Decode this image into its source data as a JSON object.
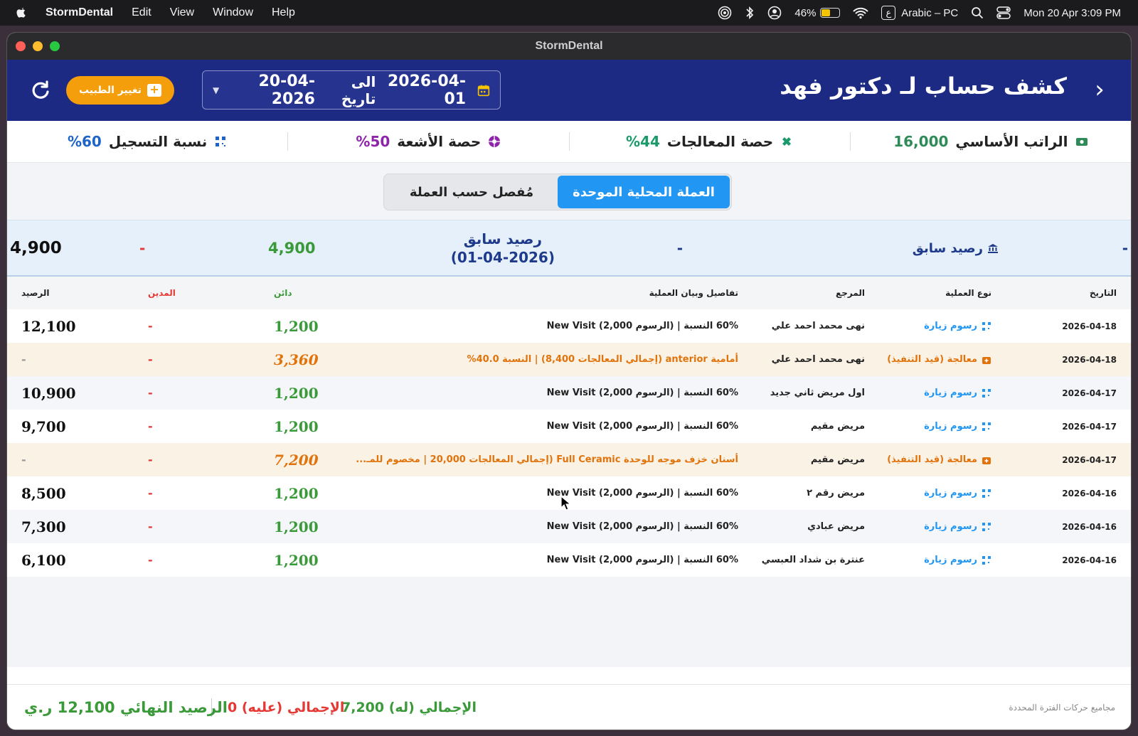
{
  "menubar": {
    "app_name": "StormDental",
    "menus": [
      "Edit",
      "View",
      "Window",
      "Help"
    ],
    "battery_percent": "46%",
    "battery_level": 0.46,
    "input_source": "Arabic – PC",
    "input_indicator": "ع",
    "datetime": "Mon 20 Apr  3:09 PM"
  },
  "window": {
    "title": "StormDental"
  },
  "header": {
    "title": "كشف حساب لـ دكتور فهد",
    "date_from": "2026-04-01",
    "date_sep": "الى تاريخ",
    "date_to": "20-04-2026",
    "change_doctor": "تغيير الطبيب"
  },
  "stats": [
    {
      "label": "الراتب الأساسي",
      "value": "16,000",
      "color": "#2e8b57",
      "icon": "money-icon"
    },
    {
      "label": "حصة المعالجات",
      "value": "%44",
      "color": "#1a9a6a",
      "icon": "tooth-icon"
    },
    {
      "label": "حصة الأشعة",
      "value": "%50",
      "color": "#8e24aa",
      "icon": "xray-icon"
    },
    {
      "label": "نسبة التسجيل",
      "value": "%60",
      "color": "#1e64c8",
      "icon": "qr-icon"
    }
  ],
  "toggle": {
    "active": "العملة المحلية الموحدة",
    "inactive": "مُفصل حسب العملة"
  },
  "previous": {
    "dash": "-",
    "label": "رصيد سابق",
    "mid_dash": "-",
    "mid_label": "رصيد سابق",
    "mid_date": "(01-04-2026)",
    "credit": "4,900",
    "debit": "-",
    "balance": "4,900"
  },
  "columns": {
    "date": "التاريخ",
    "type": "نوع العملية",
    "ref": "المرجع",
    "details": "تفاصيل وبيان العملية",
    "credit": "دائن",
    "debit": "المدين",
    "balance": "الرصيد"
  },
  "rows": [
    {
      "date": "2026-04-18",
      "type": "رسوم زيارة",
      "ref": "نهى محمد احمد علي",
      "details": "60% النسبة | (الرسوم 2,000) New Visit",
      "credit": "1,200",
      "debit": "-",
      "balance": "12,100"
    },
    {
      "date": "2026-04-18",
      "type": "معالجة (قيد التنفيذ)",
      "ref": "نهى محمد احمد علي",
      "details": "أمامية anterior (إجمالي المعالجات 8,400) | النسبة 40.0%",
      "credit": "3,360",
      "debit": "-",
      "balance": "-"
    },
    {
      "date": "2026-04-17",
      "type": "رسوم زيارة",
      "ref": "اول مريض ثاني جديد",
      "details": "60% النسبة | (الرسوم 2,000) New Visit",
      "credit": "1,200",
      "debit": "-",
      "balance": "10,900"
    },
    {
      "date": "2026-04-17",
      "type": "رسوم زيارة",
      "ref": "مريض مقيم",
      "details": "60% النسبة | (الرسوم 2,000) New Visit",
      "credit": "1,200",
      "debit": "-",
      "balance": "9,700"
    },
    {
      "date": "2026-04-17",
      "type": "معالجة (قيد التنفيذ)",
      "ref": "مريض مقيم",
      "details": "أسنان خزف موجه للوحدة Full Ceramic (إجمالي المعالجات 20,000 | مخصوم للمـ...",
      "credit": "7,200",
      "debit": "-",
      "balance": "-"
    },
    {
      "date": "2026-04-16",
      "type": "رسوم زيارة",
      "ref": "مريض رقم ٢",
      "details": "60% النسبة | (الرسوم 2,000) New Visit",
      "credit": "1,200",
      "debit": "-",
      "balance": "8,500"
    },
    {
      "date": "2026-04-16",
      "type": "رسوم زيارة",
      "ref": "مريض عبادي",
      "details": "60% النسبة | (الرسوم 2,000) New Visit",
      "credit": "1,200",
      "debit": "-",
      "balance": "7,300"
    },
    {
      "date": "2026-04-16",
      "type": "رسوم زيارة",
      "ref": "عنترة بن شداد العبسي",
      "details": "60% النسبة | (الرسوم 2,000) New Visit",
      "credit": "1,200",
      "debit": "-",
      "balance": "6,100"
    }
  ],
  "footer": {
    "caption": "مجاميع حركات الفترة المحددة",
    "total_credit_label": "الإجمالي (له)",
    "total_credit": "7,200",
    "total_debit_label": "الإجمالي (عليه)",
    "total_debit": "0",
    "final_label": "الرصيد النهائي",
    "final_value": "12,100 ر.ي"
  }
}
